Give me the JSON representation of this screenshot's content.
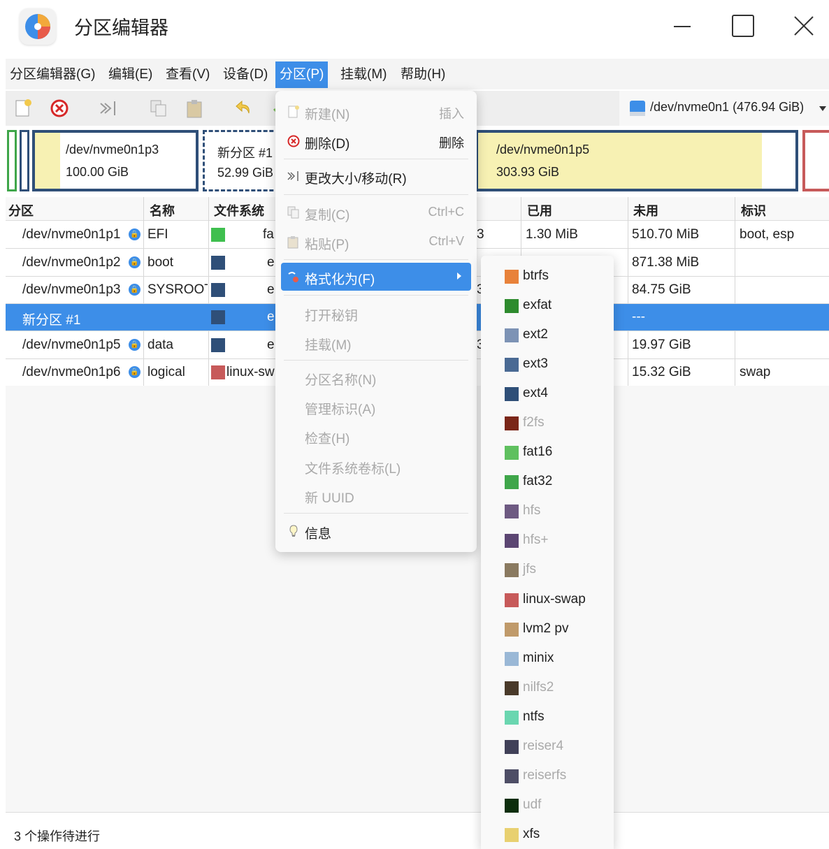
{
  "window": {
    "title": "分区编辑器"
  },
  "menubar": {
    "items": [
      {
        "label": "分区编辑器(G)"
      },
      {
        "label": "编辑(E)"
      },
      {
        "label": "查看(V)"
      },
      {
        "label": "设备(D)"
      },
      {
        "label": "分区(P)"
      },
      {
        "label": "挂载(M)"
      },
      {
        "label": "帮助(H)"
      }
    ]
  },
  "toolbar": {
    "icons": [
      "new-partition-icon",
      "delete-icon",
      "resize-move-icon",
      "copy-icon",
      "paste-icon",
      "undo-icon",
      "apply-icon"
    ],
    "device": "/dev/nvme0n1 (476.94 GiB)"
  },
  "partition_bar": [
    {
      "name": "/dev/nvme0n1p3",
      "size": "100.00 GiB"
    },
    {
      "name": "新分区 #1",
      "size": "52.99 GiB"
    },
    {
      "name": "/dev/nvme0n1p5",
      "size": "303.93 GiB"
    }
  ],
  "table": {
    "headers": [
      "分区",
      "名称",
      "文件系统",
      "已用",
      "未用",
      "标识"
    ],
    "rows": [
      {
        "partition": "/dev/nvme0n1p1",
        "name": "EFI",
        "fs": "fa",
        "size_frag": "3",
        "used": "1.30 MiB",
        "unused": "510.70 MiB",
        "flags": "boot, esp",
        "swatch": "#3fbf4f"
      },
      {
        "partition": "/dev/nvme0n1p2",
        "name": "boot",
        "fs": "e",
        "size_frag": "",
        "used": "",
        "unused": "871.38 MiB",
        "flags": "",
        "swatch": "#2f4f78"
      },
      {
        "partition": "/dev/nvme0n1p3",
        "name": "SYSROOT",
        "fs": "e",
        "size_frag": "3",
        "used": "",
        "unused": "84.75 GiB",
        "flags": "",
        "swatch": "#2f4f78"
      },
      {
        "partition": "新分区 #1",
        "name": "",
        "fs": "e",
        "size_frag": "",
        "used": "",
        "unused": "---",
        "flags": "",
        "swatch": "#2f4f78"
      },
      {
        "partition": "/dev/nvme0n1p5",
        "name": "data",
        "fs": "e",
        "size_frag": "3",
        "used": "",
        "unused": "19.97 GiB",
        "flags": "",
        "swatch": "#2f4f78"
      },
      {
        "partition": "/dev/nvme0n1p6",
        "name": "logical",
        "fs": "linux-sw",
        "size_frag": "",
        "used": "",
        "unused": "15.32 GiB",
        "flags": "swap",
        "swatch": "#c75a5a"
      }
    ]
  },
  "dropdown": {
    "items": [
      {
        "label": "新建(N)",
        "accel": "插入",
        "disabled": true,
        "icon": "new-icon"
      },
      {
        "label": "删除(D)",
        "accel": "删除",
        "disabled": false,
        "icon": "delete-icon"
      },
      {
        "label": "更改大小/移动(R)",
        "accel": "",
        "disabled": false,
        "icon": "resize-icon"
      },
      {
        "label": "复制(C)",
        "accel": "Ctrl+C",
        "disabled": true,
        "icon": "copy-icon"
      },
      {
        "label": "粘贴(P)",
        "accel": "Ctrl+V",
        "disabled": true,
        "icon": "paste-icon"
      },
      {
        "label": "格式化为(F)",
        "accel": "",
        "disabled": false,
        "icon": "format-icon"
      },
      {
        "label": "打开秘钥",
        "accel": "",
        "disabled": true,
        "icon": ""
      },
      {
        "label": "挂载(M)",
        "accel": "",
        "disabled": true,
        "icon": ""
      },
      {
        "label": "分区名称(N)",
        "accel": "",
        "disabled": true,
        "icon": ""
      },
      {
        "label": "管理标识(A)",
        "accel": "",
        "disabled": true,
        "icon": ""
      },
      {
        "label": "检查(H)",
        "accel": "",
        "disabled": true,
        "icon": ""
      },
      {
        "label": "文件系统卷标(L)",
        "accel": "",
        "disabled": true,
        "icon": ""
      },
      {
        "label": "新 UUID",
        "accel": "",
        "disabled": true,
        "icon": ""
      },
      {
        "label": "信息",
        "accel": "",
        "disabled": false,
        "icon": "info-icon"
      }
    ]
  },
  "format_submenu": [
    {
      "label": "btrfs",
      "color": "#e8823a",
      "disabled": false
    },
    {
      "label": "exfat",
      "color": "#2e8b2e",
      "disabled": false
    },
    {
      "label": "ext2",
      "color": "#7d93b5",
      "disabled": false
    },
    {
      "label": "ext3",
      "color": "#4a6a94",
      "disabled": false
    },
    {
      "label": "ext4",
      "color": "#2f4f78",
      "disabled": false
    },
    {
      "label": "f2fs",
      "color": "#7a2618",
      "disabled": true
    },
    {
      "label": "fat16",
      "color": "#5fc05f",
      "disabled": false
    },
    {
      "label": "fat32",
      "color": "#3fa64a",
      "disabled": false
    },
    {
      "label": "hfs",
      "color": "#6e5a82",
      "disabled": true
    },
    {
      "label": "hfs+",
      "color": "#5c4673",
      "disabled": true
    },
    {
      "label": "jfs",
      "color": "#8a7a60",
      "disabled": true
    },
    {
      "label": "linux-swap",
      "color": "#c75a5a",
      "disabled": false
    },
    {
      "label": "lvm2 pv",
      "color": "#c09a6a",
      "disabled": false
    },
    {
      "label": "minix",
      "color": "#9ab8d6",
      "disabled": false
    },
    {
      "label": "nilfs2",
      "color": "#4a3a2a",
      "disabled": true
    },
    {
      "label": "ntfs",
      "color": "#6ad6b0",
      "disabled": false
    },
    {
      "label": "reiser4",
      "color": "#404058",
      "disabled": true
    },
    {
      "label": "reiserfs",
      "color": "#4e4e66",
      "disabled": true
    },
    {
      "label": "udf",
      "color": "#0d2e0d",
      "disabled": true
    },
    {
      "label": "xfs",
      "color": "#e8d070",
      "disabled": false
    }
  ],
  "status": {
    "text": "3 个操作待进行"
  }
}
